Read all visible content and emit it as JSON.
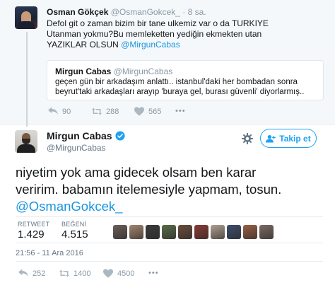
{
  "parent_tweet": {
    "author_name": "Osman Gökçek",
    "author_handle": "@OsmanGokcek_",
    "separator": "·",
    "time": "8 sa.",
    "text_lines": [
      "Defol git o zaman  bizim bir tane ulkemiz var o da TURKIYE",
      "Utanman yokmu?Bu memleketten yediğin ekmekten utan",
      "YAZIKLAR OLSUN "
    ],
    "text_mention": "@MirgunCabas",
    "quoted": {
      "author_name": "Mirgun Cabas",
      "author_handle": "@MirgunCabas",
      "text_lines": [
        "geçen gün bir arkadaşım anlattı.. istanbul'daki her bombadan sonra",
        "beyrut'taki arkadaşları arayıp 'buraya gel, burası güvenli' diyorlarmış.."
      ]
    },
    "actions": {
      "reply_count": "90",
      "retweet_count": "288",
      "like_count": "565",
      "more": "•••"
    }
  },
  "main_tweet": {
    "author_name": "Mirgun Cabas",
    "author_handle": "@MirgunCabas",
    "follow_label": "Takip et",
    "text_lines": [
      "niyetim yok ama gidecek olsam ben karar",
      "veririm. babamın itelemesiyle yapmam, tosun."
    ],
    "text_mention": "@OsmanGokcek_",
    "stats": {
      "retweet_label": "RETWEET",
      "retweet_value": "1.429",
      "like_label": "BEĞENİ",
      "like_value": "4.515"
    },
    "timestamp": "21:56 - 11 Ara 2016",
    "actions": {
      "reply_count": "252",
      "retweet_count": "1400",
      "like_count": "4500",
      "more": "•••"
    }
  },
  "colors": {
    "accent": "#1da1f2",
    "mention": "#1b95e0",
    "muted": "#8899a6",
    "header_bg": "#f5f8fa"
  },
  "liker_avatar_colors": [
    "#6b5e58",
    "#a3866d",
    "#3b3b3d",
    "#5a6b48",
    "#6a4c3b",
    "#8a3b34",
    "#b0a090",
    "#3d4d6b",
    "#9a5f44",
    "#7d6a63"
  ]
}
